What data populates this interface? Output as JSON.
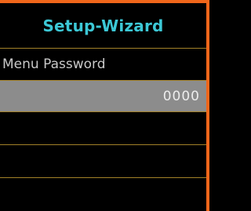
{
  "window": {
    "title": "Setup-Wizard"
  },
  "field": {
    "label": "Menu Password",
    "value": "0000"
  },
  "colors": {
    "accent_orange": "#f0661a",
    "title_cyan": "#3cc8d6",
    "divider_gold": "#a38128",
    "label_text": "#c8c8c8",
    "selected_row_bg": "#8c8c8c",
    "selected_row_text": "#ededed",
    "background": "#000000"
  }
}
